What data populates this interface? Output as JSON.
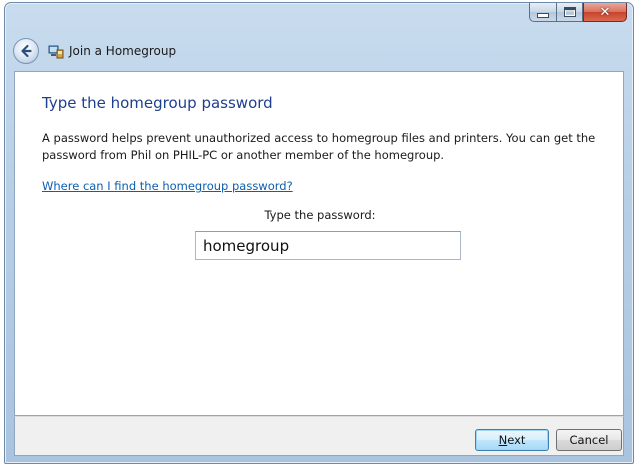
{
  "window": {
    "title": "Join a Homegroup",
    "controls": {
      "minimize_icon": "minimize-icon",
      "maximize_icon": "maximize-icon",
      "close_icon": "close-icon"
    }
  },
  "nav": {
    "back_icon": "back-arrow-icon",
    "title_icon": "homegroup-icon"
  },
  "main": {
    "heading": "Type the homegroup password",
    "description": "A password helps prevent unauthorized access to homegroup files and printers. You can get the password from Phil on PHIL-PC or another member of the homegroup.",
    "help_link": "Where can I find the homegroup password?",
    "password_label": "Type the password:",
    "password_value": "homegroup"
  },
  "footer": {
    "next_label_accel": "N",
    "next_label_rest": "ext",
    "cancel_label": "Cancel"
  },
  "colors": {
    "heading": "#1e3f8f",
    "link": "#0b5fb0",
    "chrome": "#b8cfe6"
  }
}
